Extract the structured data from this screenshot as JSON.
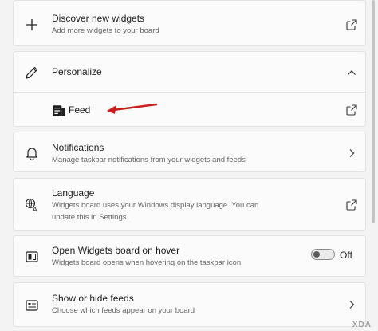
{
  "discover": {
    "title": "Discover new widgets",
    "subtitle": "Add more widgets to your board"
  },
  "personalize": {
    "title": "Personalize"
  },
  "feed": {
    "label": "Feed"
  },
  "notifications": {
    "title": "Notifications",
    "subtitle": "Manage taskbar notifications from your widgets and feeds"
  },
  "language": {
    "title": "Language",
    "subtitle_line1": "Widgets board uses your Windows display language. You can",
    "subtitle_line2": "update this in Settings."
  },
  "hover": {
    "title": "Open Widgets board on hover",
    "subtitle": "Widgets board opens when hovering on the taskbar icon",
    "toggle_state": "Off"
  },
  "feeds_toggle": {
    "title": "Show or hide feeds",
    "subtitle": "Choose which feeds appear on your board"
  },
  "watermark": "XDA",
  "colors": {
    "annotation_arrow": "#cc1d1d",
    "background": "#f3f3f3",
    "card": "#fbfbfb"
  }
}
